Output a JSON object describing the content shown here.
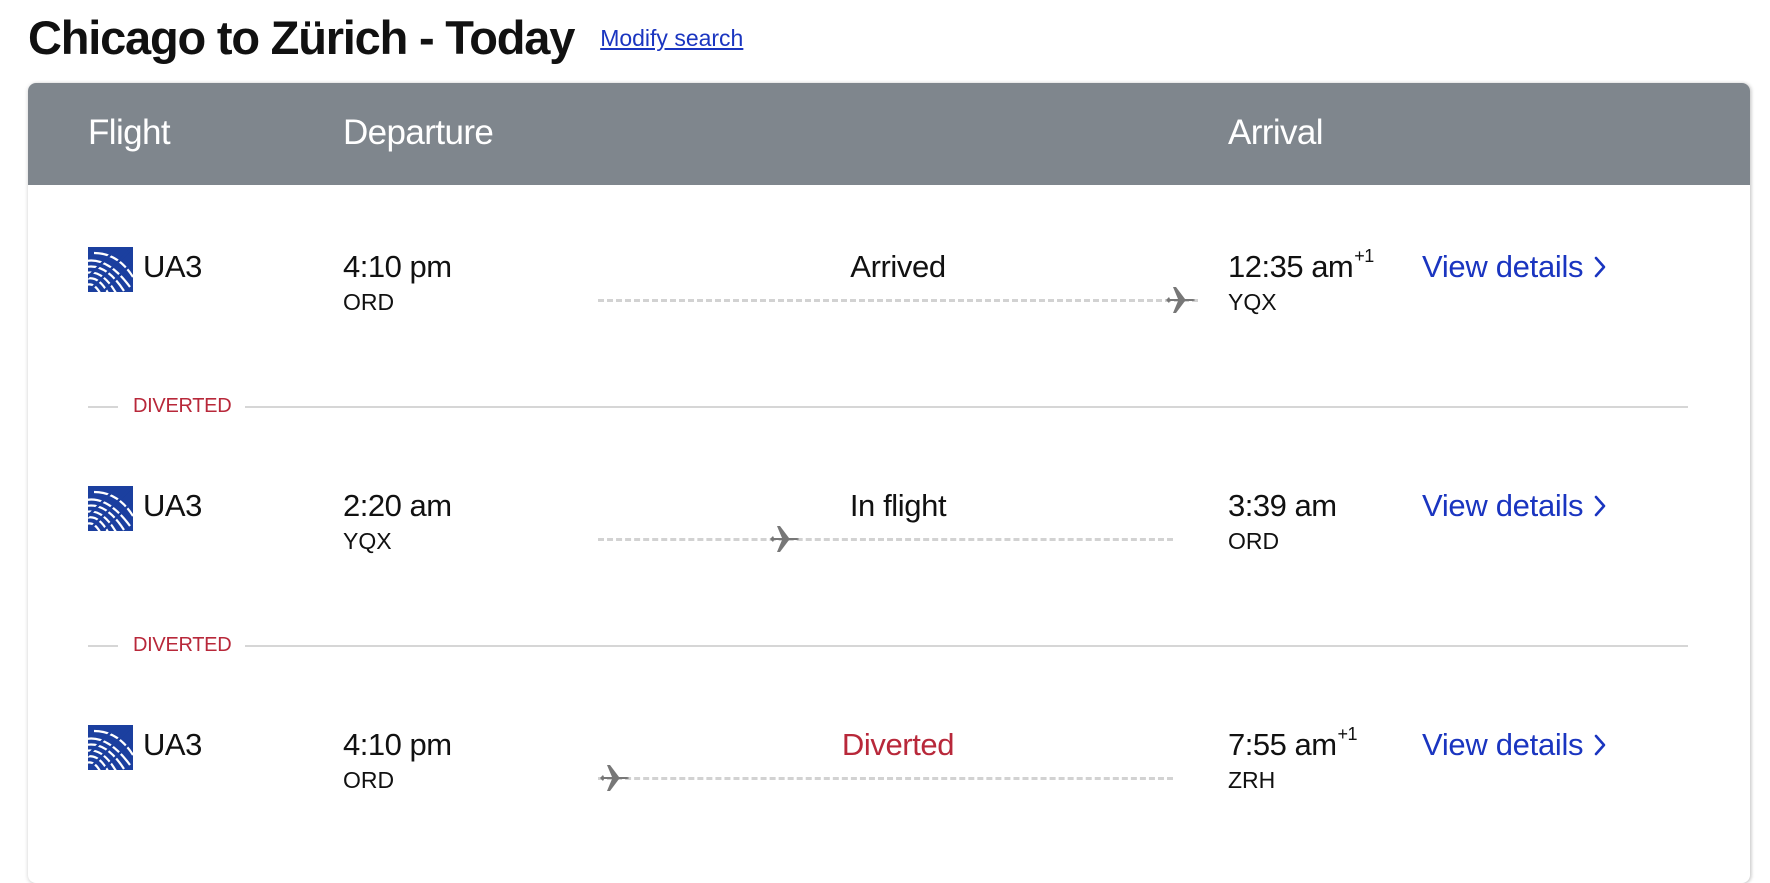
{
  "page": {
    "title": "Chicago to Zürich - Today",
    "modify_label": "Modify search"
  },
  "table": {
    "headers": {
      "flight": "Flight",
      "departure": "Departure",
      "arrival": "Arrival"
    }
  },
  "colors": {
    "header_bg": "#7f868d",
    "link": "#1a35c0",
    "diverted": "#b8283a",
    "airline_blue": "#1b3f9f"
  },
  "flights": [
    {
      "airline_icon": "united-globe-icon",
      "flight_number": "UA3",
      "departure_time": "4:10 pm",
      "departure_airport": "ORD",
      "status": "Arrived",
      "status_kind": "normal",
      "progress": 1.0,
      "arrival_time": "12:35 am",
      "arrival_day_offset": "+1",
      "arrival_airport": "YQX",
      "details_label": "View details"
    },
    {
      "airline_icon": "united-globe-icon",
      "flight_number": "UA3",
      "departure_time": "2:20 am",
      "departure_airport": "YQX",
      "status": "In flight",
      "status_kind": "normal",
      "progress": 0.3,
      "arrival_time": "3:39 am",
      "arrival_day_offset": "",
      "arrival_airport": "ORD",
      "details_label": "View details"
    },
    {
      "airline_icon": "united-globe-icon",
      "flight_number": "UA3",
      "departure_time": "4:10 pm",
      "departure_airport": "ORD",
      "status": "Diverted",
      "status_kind": "diverted",
      "progress": 0.0,
      "arrival_time": "7:55 am",
      "arrival_day_offset": "+1",
      "arrival_airport": "ZRH",
      "details_label": "View details"
    }
  ],
  "dividers": [
    {
      "label": "DIVERTED"
    },
    {
      "label": "DIVERTED"
    }
  ]
}
